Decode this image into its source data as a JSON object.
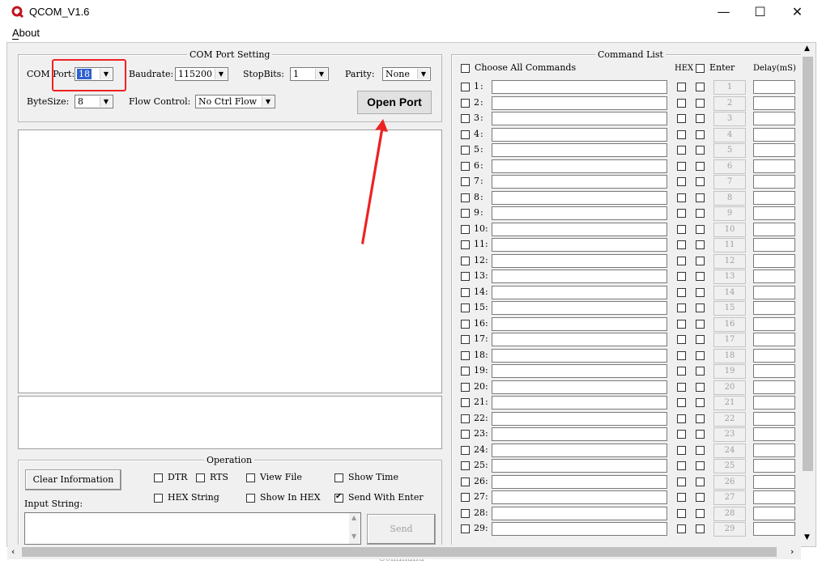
{
  "window": {
    "title": "QCOM_V1.6",
    "minimize": "—",
    "maximize": "☐",
    "close": "✕"
  },
  "menu": {
    "about": "About"
  },
  "com_port_setting": {
    "legend": "COM Port Setting",
    "com_port_label": "COM Port:",
    "com_port_value": "18",
    "baudrate_label": "Baudrate:",
    "baudrate_value": "115200",
    "stopbits_label": "StopBits:",
    "stopbits_value": "1",
    "parity_label": "Parity:",
    "parity_value": "None",
    "bytesize_label": "ByteSize:",
    "bytesize_value": "8",
    "flow_label": "Flow Control:",
    "flow_value": "No Ctrl Flow",
    "open_port": "Open Port"
  },
  "operation": {
    "legend": "Operation",
    "clear_info": "Clear Information",
    "dtr": "DTR",
    "rts": "RTS",
    "view_file": "View File",
    "show_time": "Show Time",
    "hex_string": "HEX String",
    "show_in_hex": "Show In HEX",
    "send_with_enter": "Send With Enter",
    "send_with_enter_checked": true,
    "input_string_label": "Input String:",
    "send_command": "Send Command"
  },
  "command_list": {
    "legend": "Command List",
    "choose_all": "Choose All Commands",
    "hex_header": "HEX",
    "enter_header": "Enter",
    "delay_header": "Delay(mS)",
    "rows": [
      "1",
      "2",
      "3",
      "4",
      "5",
      "6",
      "7",
      "8",
      "9",
      "10",
      "11",
      "12",
      "13",
      "14",
      "15",
      "16",
      "17",
      "18",
      "19",
      "20",
      "21",
      "22",
      "23",
      "24",
      "25",
      "26",
      "27",
      "28",
      "29"
    ]
  },
  "annotation": {
    "color": "#ee2222"
  }
}
